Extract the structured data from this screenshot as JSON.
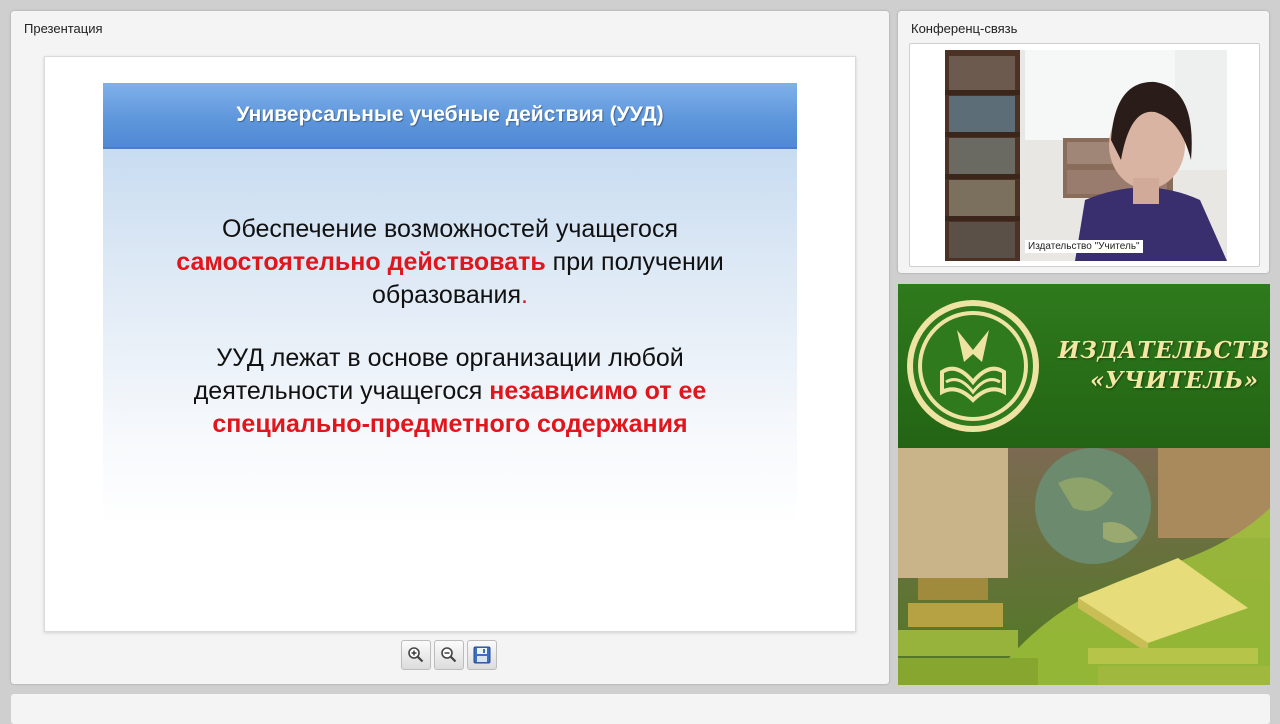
{
  "presentation": {
    "panel_title": "Презентация",
    "slide": {
      "title": "Универсальные учебные действия (УУД)",
      "para1": {
        "line1": "Обеспечение возможностей учащегося",
        "emphasis": "самостоятельно действовать",
        "after_emphasis": " при получении",
        "line3": "образования",
        "period": "."
      },
      "para2": {
        "line1": "УУД лежат в основе организации любой",
        "line2_plain": "деятельности учащегося ",
        "line2_emphasis": "независимо от ее",
        "line3_emphasis": "специально-предметного содержания"
      },
      "colors": {
        "header": "#5f97dc",
        "emphasis": "#e0161c"
      }
    },
    "toolbar": {
      "zoom_in": "zoom-in-icon",
      "zoom_out": "zoom-out-icon",
      "save": "save-icon"
    }
  },
  "conference": {
    "panel_title": "Конференц-связь",
    "video_label": "Издательство \"Учитель\""
  },
  "publisher": {
    "name_line1": "ИЗДАТЕЛЬСТВО",
    "name_line2": "«УЧИТЕЛЬ»",
    "brand_color": "#2f6d19",
    "text_color": "#f4e7a4"
  }
}
